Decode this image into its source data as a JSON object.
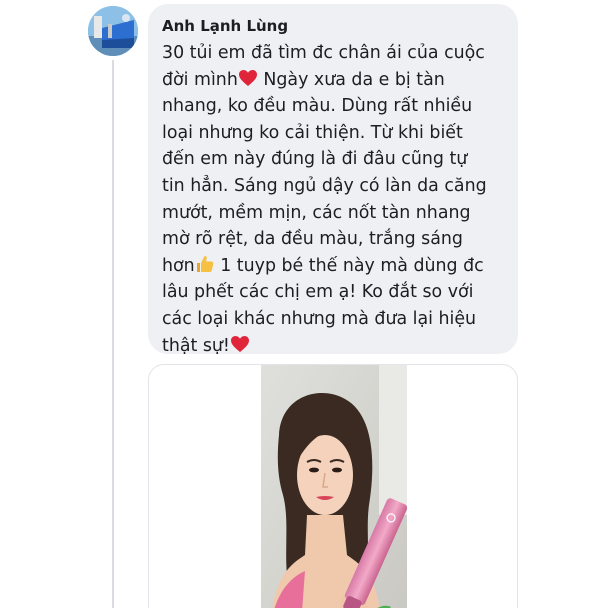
{
  "comment": {
    "author": "Anh Lạnh Lùng",
    "lines": [
      [
        "30 tủi em đã tìm đc chân ái của cuộc",
        null
      ],
      [
        "đời mình",
        "heart"
      ],
      [
        " Ngày xưa da e bị tàn",
        null
      ],
      [
        "nhang, ko đều màu. Dùng rất nhiều",
        null
      ],
      [
        "loại nhưng ko cải thiện. Từ khi biết",
        null
      ],
      [
        "đến em này đúng là đi đâu cũng tự",
        null
      ],
      [
        "tin hẳn. Sáng ngủ dậy có làn da căng",
        null
      ],
      [
        "mướt, mềm mịn, các nốt tàn nhang",
        null
      ],
      [
        "mờ rõ rệt, da đều màu, trắng sáng",
        null
      ],
      [
        "hơn",
        "thumb"
      ],
      [
        " 1 tuyp bé thế này mà dùng đc",
        null
      ],
      [
        "lâu phết các chị em ạ! Ko đắt so với",
        null
      ],
      [
        "các loại khác nhưng mà đưa lại hiệu",
        null
      ],
      [
        "thật sự!",
        "heart"
      ]
    ],
    "text_line_1": "30 tủi em đã tìm đc chân ái của cuộc",
    "text_line_2a": "đời mình",
    "text_line_2b": " Ngày xưa da e bị tàn",
    "text_line_3": "nhang, ko đều màu. Dùng rất nhiều",
    "text_line_4": "loại nhưng ko cải thiện. Từ khi biết",
    "text_line_5": "đến em này đúng là đi đâu cũng tự",
    "text_line_6": "tin hẳn. Sáng ngủ dậy có làn da căng",
    "text_line_7": "mướt, mềm mịn, các nốt tàn nhang",
    "text_line_8": "mờ rõ rệt, da đều màu, trắng sáng",
    "text_line_9a": "hơn",
    "text_line_9b": " 1 tuyp bé thế này mà dùng đc",
    "text_line_10": "lâu phết các chị em ạ! Ko đắt so với",
    "text_line_11": "các loại khác nhưng mà đưa lại hiệu",
    "text_line_12": "thật sự!"
  },
  "icons": {
    "avatar": "avatar-photo",
    "heart": "red-heart-emoji",
    "thumb": "thumbs-up-emoji"
  },
  "colors": {
    "bubble_bg": "#eef0f4",
    "text": "#1c1e21",
    "heart": "#e0243a",
    "thumb": "#f6c142"
  }
}
